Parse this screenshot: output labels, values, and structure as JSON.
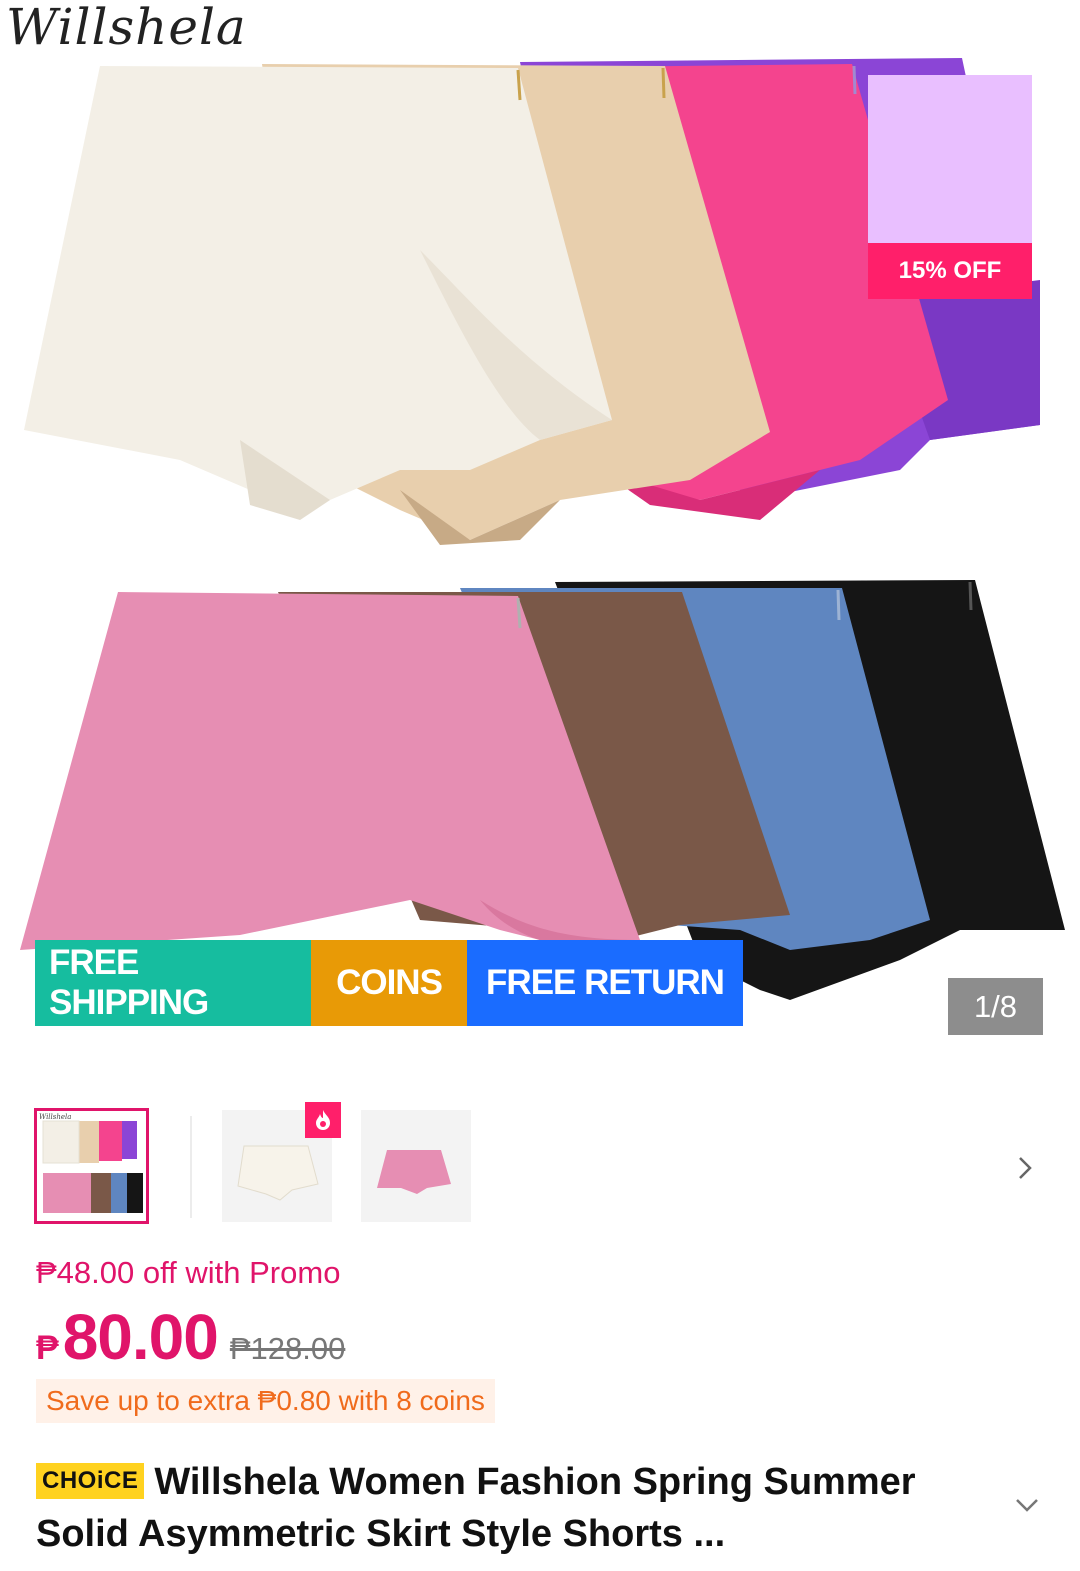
{
  "gallery": {
    "brand": "Willshela",
    "discount_label": "15% OFF",
    "tags": {
      "shipping": "FREE SHIPPING",
      "coins": "COINS",
      "return": "FREE RETURN"
    },
    "counter": "1/8",
    "colors": {
      "cream": "#f3efe6",
      "beige": "#e8cfad",
      "hot_pink": "#f4448e",
      "purple": "#8b45d6",
      "pink": "#e68eb3",
      "brown": "#7a5848",
      "blue": "#5f86c0",
      "black": "#151515"
    }
  },
  "thumbnails": {
    "brand_mini": "Willshela",
    "next_icon": "chevron-right-icon",
    "hot_icon": "flame-icon"
  },
  "price": {
    "promo": "₱48.00 off with Promo",
    "currency": "₱",
    "current": "80.00",
    "original": "₱128.00",
    "coins_note": "Save up to extra ₱0.80 with 8 coins"
  },
  "product": {
    "choice_badge": "CHOiCE",
    "title": "Willshela Women Fashion Spring Summer Solid Asymmetric Skirt Style Shorts ...",
    "expand_icon": "chevron-down-icon"
  }
}
